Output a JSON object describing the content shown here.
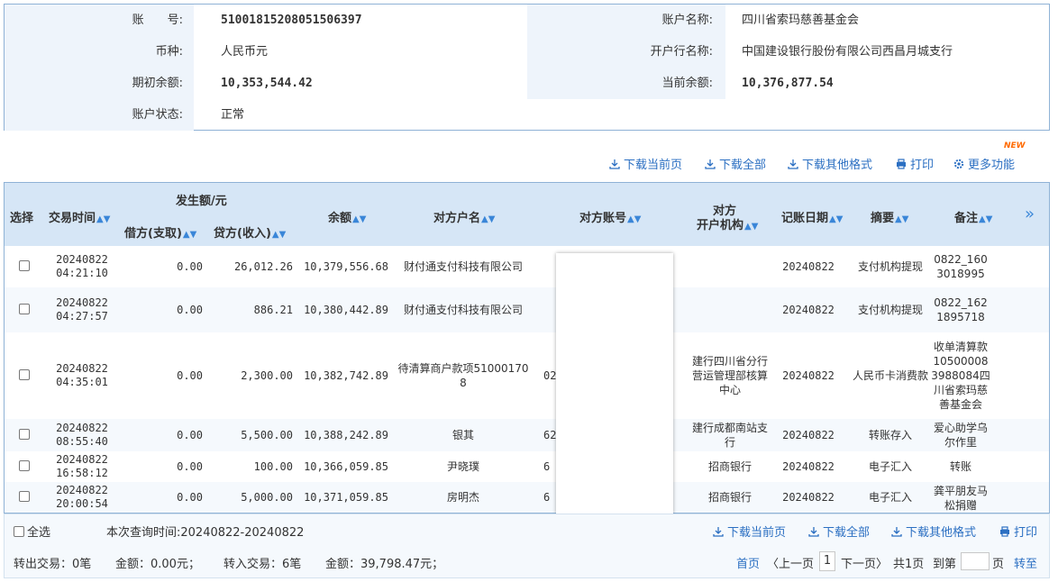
{
  "account": {
    "no_label": "账　　号:",
    "no_value": "51001815208051506397",
    "name_label": "账户名称:",
    "name_value": "四川省索玛慈善基金会",
    "currency_label": "币种:",
    "currency_value": "人民币元",
    "bank_label": "开户行名称:",
    "bank_value": "中国建设银行股份有限公司西昌月城支行",
    "opening_label": "期初余额:",
    "opening_value": "10,353,544.42",
    "current_label": "当前余额:",
    "current_value": "10,376,877.54",
    "status_label": "账户状态:",
    "status_value": "正常"
  },
  "toolbar": {
    "download_page": "下载当前页",
    "download_all": "下载全部",
    "download_other": "下载其他格式",
    "print": "打印",
    "more": "更多功能",
    "new_badge": "NEW"
  },
  "table": {
    "headers": {
      "select": "选择",
      "time": "交易时间",
      "amount_group": "发生额/元",
      "debit": "借方(支取)",
      "credit": "贷方(收入)",
      "balance": "余额",
      "counterparty": "对方户名",
      "account": "对方账号",
      "bank_line1": "对方",
      "bank_line2": "开户机构",
      "post_date": "记账日期",
      "summary": "摘要",
      "remark": "备注",
      "more": "»"
    },
    "rows": [
      {
        "date": "20240822",
        "time": "04:21:10",
        "debit": "0.00",
        "credit": "26,012.26",
        "balance": "10,379,556.68",
        "name": "财付通支付科技有限公司",
        "acct": "",
        "bank": "",
        "post": "20240822",
        "summary": "支付机构提现",
        "remark": "0822_1603018995"
      },
      {
        "date": "20240822",
        "time": "04:27:57",
        "debit": "0.00",
        "credit": "886.21",
        "balance": "10,380,442.89",
        "name": "财付通支付科技有限公司",
        "acct": "",
        "bank": "",
        "post": "20240822",
        "summary": "支付机构提现",
        "remark": "0822_1621895718"
      },
      {
        "date": "20240822",
        "time": "04:35:01",
        "debit": "0.00",
        "credit": "2,300.00",
        "balance": "10,382,742.89",
        "name": "待清算商户款项510001708",
        "acct": "02",
        "bank": "建行四川省分行营运管理部核算中心",
        "post": "20240822",
        "summary": "人民币卡消费款",
        "remark": "收单清算款105000083988084四川省索玛慈善基金会"
      },
      {
        "date": "20240822",
        "time": "08:55:40",
        "debit": "0.00",
        "credit": "5,500.00",
        "balance": "10,388,242.89",
        "name": "银其",
        "acct": "62",
        "bank": "建行成都南站支行",
        "post": "20240822",
        "summary": "转账存入",
        "remark": "爱心助学乌尔作里"
      },
      {
        "date": "20240822",
        "time": "16:58:12",
        "debit": "0.00",
        "credit": "100.00",
        "balance": "10,366,059.85",
        "name": "尹晓璞",
        "acct": "6",
        "bank": "招商银行",
        "post": "20240822",
        "summary": "电子汇入",
        "remark": "转账"
      },
      {
        "date": "20240822",
        "time": "20:00:54",
        "debit": "0.00",
        "credit": "5,000.00",
        "balance": "10,371,059.85",
        "name": "房明杰",
        "acct": "6",
        "bank": "招商银行",
        "post": "20240822",
        "summary": "电子汇入",
        "remark": "龚平朋友马松捐赠"
      }
    ]
  },
  "footer": {
    "select_all": "全选",
    "query_time": "本次查询时间:20240822-20240822",
    "download_page": "下载当前页",
    "download_all": "下载全部",
    "download_other": "下载其他格式",
    "print": "打印",
    "out_count": "转出交易：0笔",
    "out_amount": "金额：0.00元；",
    "in_count": "转入交易：6笔",
    "in_amount": "金额：39,798.47元；",
    "first": "首页",
    "prev": "〈上一页",
    "page": "1",
    "next": "下一页〉",
    "total": "共1页",
    "goto": "到第",
    "page_unit": "页",
    "go": "转至"
  },
  "colors": {
    "border": "#8fb2d6",
    "label_bg": "#eef4fb",
    "header_bg": "#d6e6f6",
    "link": "#2b6fc2",
    "new": "#ff6a00"
  }
}
